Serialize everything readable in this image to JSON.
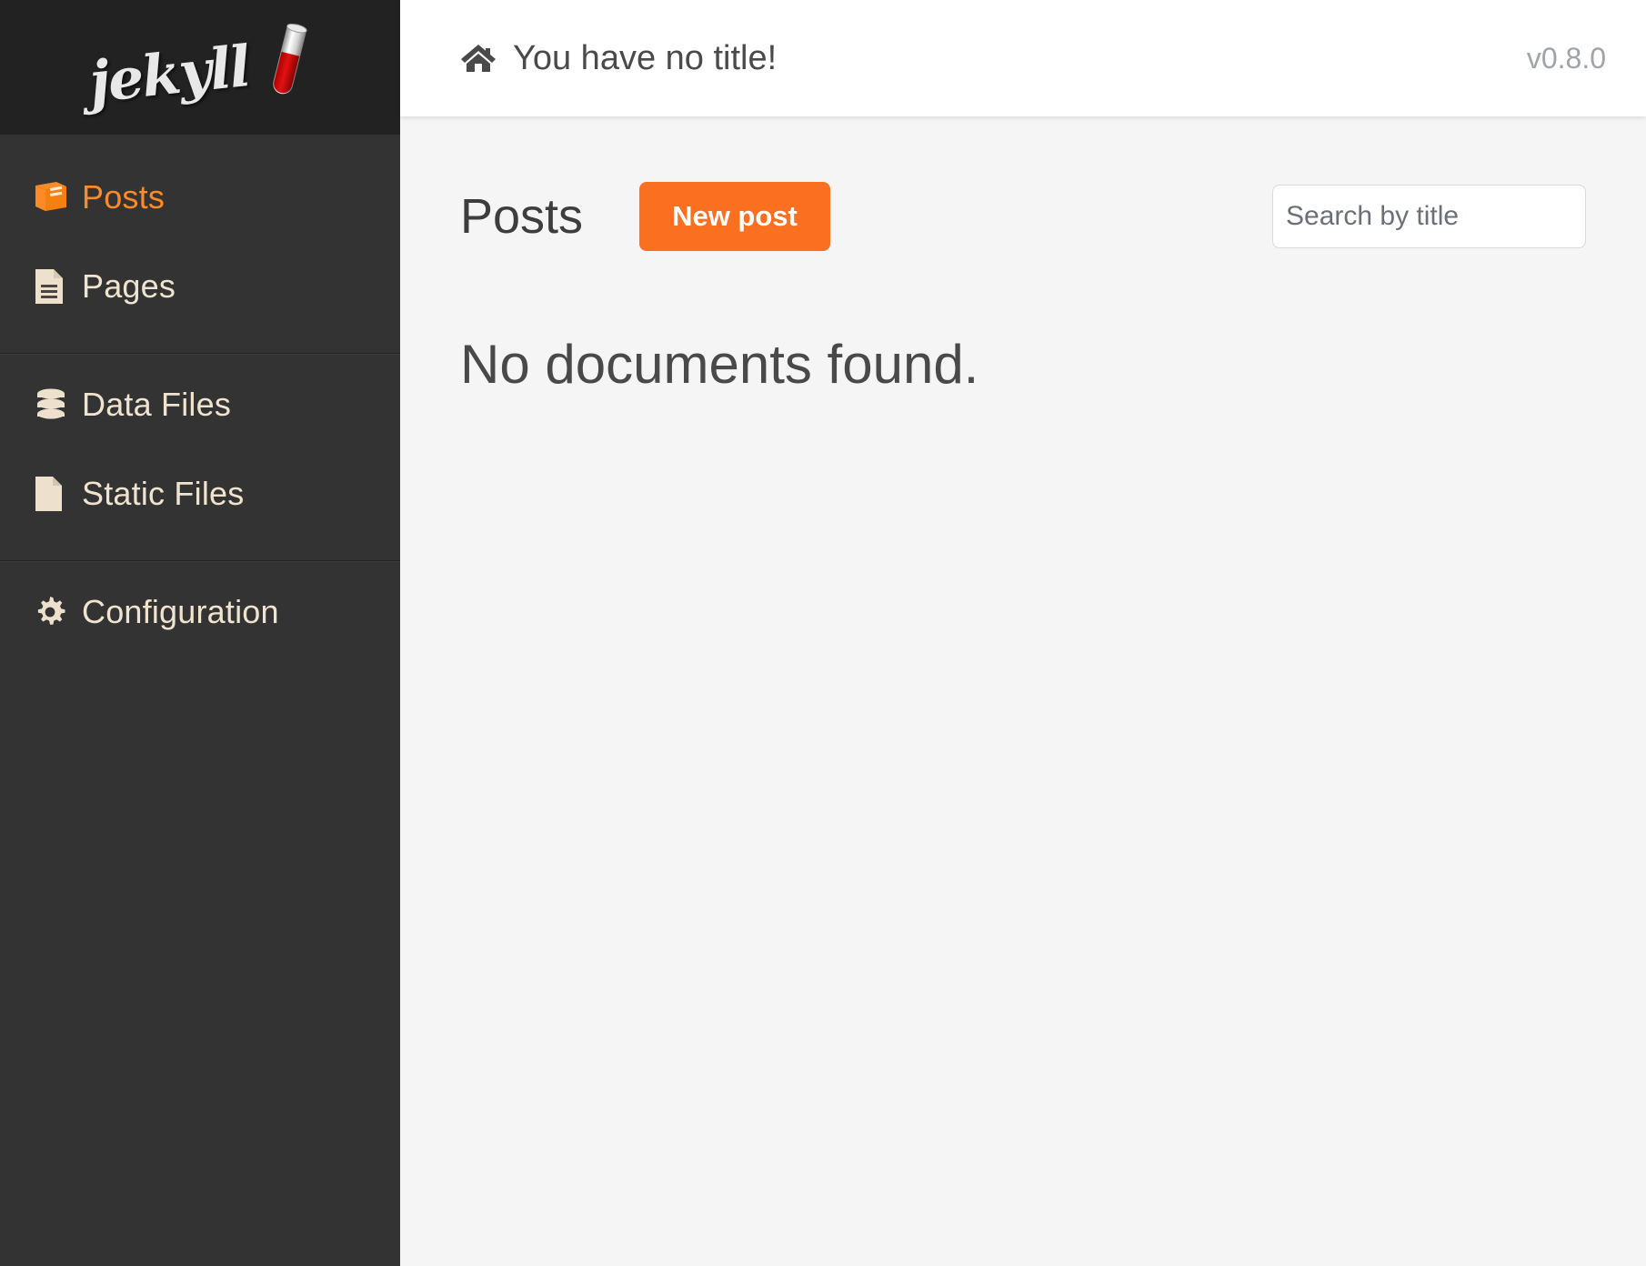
{
  "brand": {
    "logo_text": "jekyll",
    "logo_icon": "test-tube-icon",
    "accent_color": "#fb6f20",
    "sidebar_bg": "#333333",
    "logo_bg": "#222222"
  },
  "sidebar": {
    "groups": [
      {
        "items": [
          {
            "label": "Posts",
            "icon": "book-icon",
            "active": true
          },
          {
            "label": "Pages",
            "icon": "document-lines-icon",
            "active": false
          }
        ]
      },
      {
        "items": [
          {
            "label": "Data Files",
            "icon": "database-icon",
            "active": false
          },
          {
            "label": "Static Files",
            "icon": "blank-file-icon",
            "active": false
          }
        ]
      },
      {
        "items": [
          {
            "label": "Configuration",
            "icon": "gear-icon",
            "active": false
          }
        ]
      }
    ]
  },
  "topbar": {
    "home_icon": "home-icon",
    "site_title": "You have no title!",
    "version": "v0.8.0"
  },
  "content": {
    "page_title": "Posts",
    "new_post_label": "New post",
    "search": {
      "placeholder": "Search by title",
      "value": ""
    },
    "empty_message": "No documents found."
  }
}
